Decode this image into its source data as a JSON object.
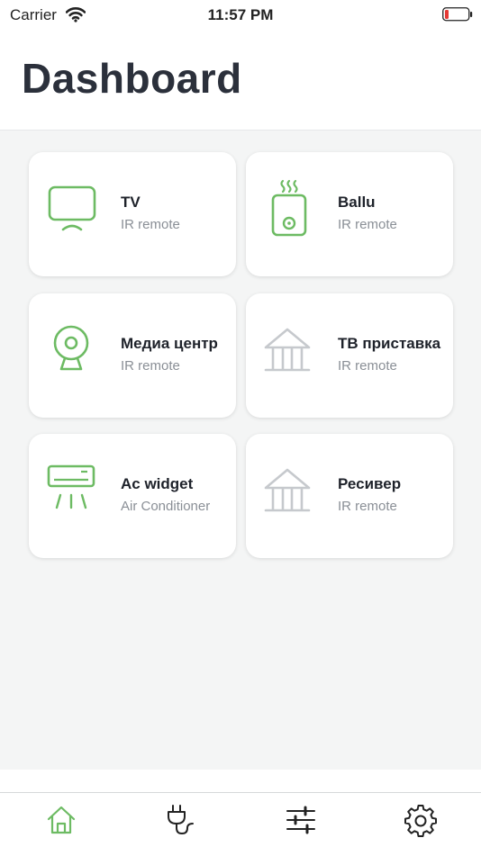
{
  "status_bar": {
    "carrier": "Carrier",
    "time": "11:57 PM",
    "wifi_icon": "wifi-icon",
    "battery_icon": "battery-low-icon",
    "battery_color": "#e53935"
  },
  "header": {
    "title": "Dashboard"
  },
  "colors": {
    "accent_green": "#6dbb63",
    "inactive_gray": "#c6c9cd",
    "background": "#f4f5f5"
  },
  "devices": [
    {
      "name": "TV",
      "type": "IR remote",
      "icon": "tv-icon"
    },
    {
      "name": "Ballu",
      "type": "IR remote",
      "icon": "heater-icon"
    },
    {
      "name": "Медиа центр",
      "type": "IR remote",
      "icon": "webcam-icon"
    },
    {
      "name": "ТВ приставка",
      "type": "IR remote",
      "icon": "house-icon"
    },
    {
      "name": "Ac widget",
      "type": "Air Conditioner",
      "icon": "air-conditioner-icon"
    },
    {
      "name": "Ресивер",
      "type": "IR remote",
      "icon": "house-icon"
    }
  ],
  "tabbar": {
    "tabs": [
      {
        "id": "home",
        "icon": "home-icon",
        "active": true
      },
      {
        "id": "devices",
        "icon": "plug-icon",
        "active": false
      },
      {
        "id": "controls",
        "icon": "sliders-icon",
        "active": false
      },
      {
        "id": "settings",
        "icon": "gear-icon",
        "active": false
      }
    ]
  }
}
